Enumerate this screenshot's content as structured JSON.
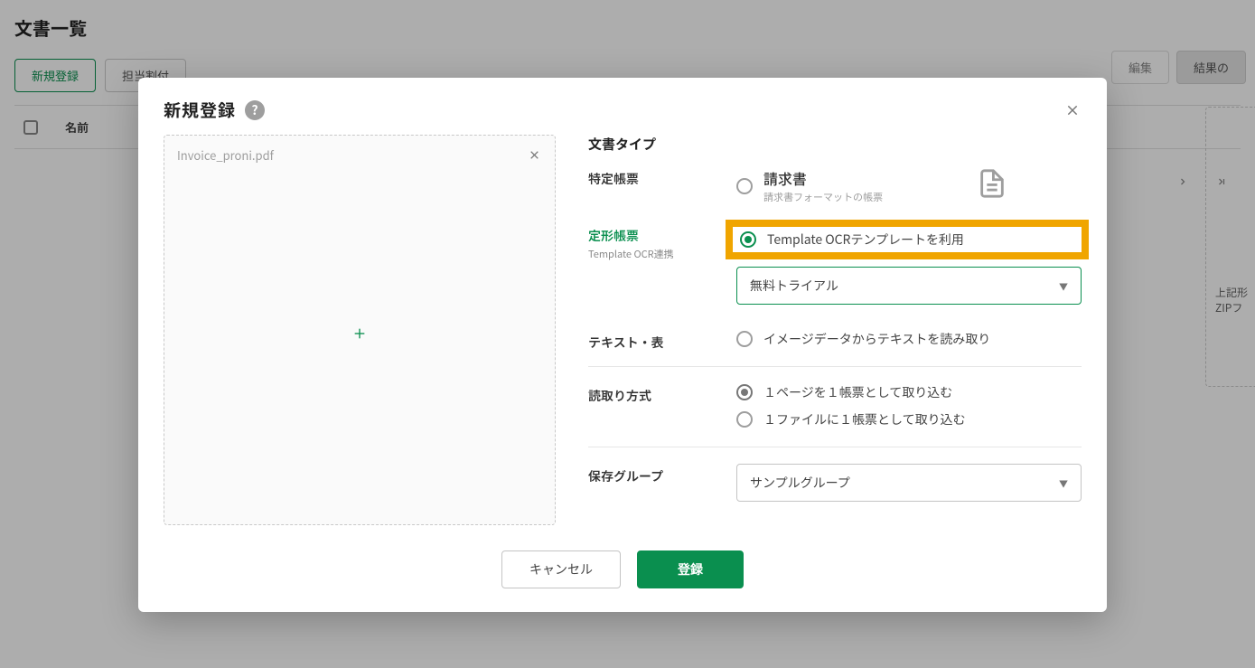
{
  "page": {
    "title": "文書一覧",
    "toolbar": {
      "new_label": "新規登録",
      "assign_label": "担当割付",
      "edit_label": "編集",
      "result_label": "結果の"
    },
    "table": {
      "col_name": "名前"
    },
    "sidebox": {
      "line1": "上記形",
      "line2": "ZIPフ"
    }
  },
  "modal": {
    "title": "新規登録",
    "file_name": "Invoice_proni.pdf",
    "form": {
      "doc_type_label": "文書タイプ",
      "specific_label": "特定帳票",
      "specific_option_main": "請求書",
      "specific_option_sub": "請求書フォーマットの帳票",
      "fixed_label": "定形帳票",
      "fixed_sub": "Template OCR連携",
      "fixed_option": "Template OCRテンプレートを利用",
      "template_select": "無料トライアル",
      "text_table_label": "テキスト・表",
      "text_table_option": "イメージデータからテキストを読み取り",
      "read_method_label": "読取り方式",
      "read_option_1": "１ページを１帳票として取り込む",
      "read_option_2": "１ファイルに１帳票として取り込む",
      "save_group_label": "保存グループ",
      "save_group_select": "サンプルグループ"
    },
    "buttons": {
      "cancel": "キャンセル",
      "submit": "登録"
    }
  }
}
